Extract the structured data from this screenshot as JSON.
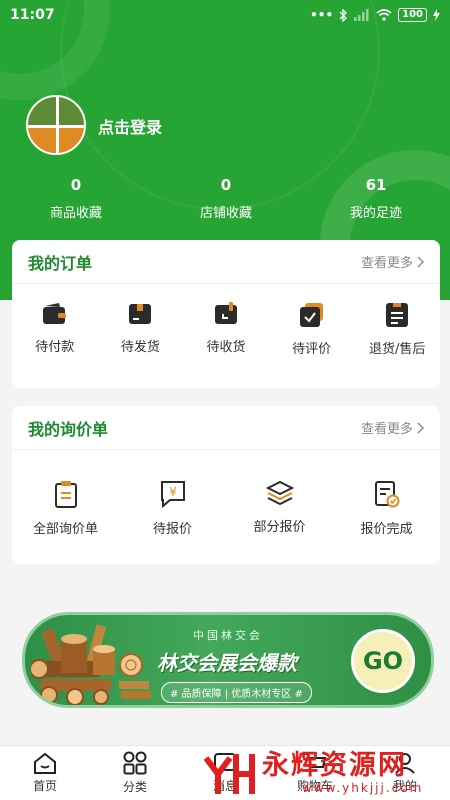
{
  "status_bar": {
    "time": "11:07",
    "battery": "100"
  },
  "profile": {
    "login_label": "点击登录"
  },
  "stats": [
    {
      "value": "0",
      "label": "商品收藏"
    },
    {
      "value": "0",
      "label": "店铺收藏"
    },
    {
      "value": "61",
      "label": "我的足迹"
    }
  ],
  "orders": {
    "title": "我的订单",
    "more": "查看更多",
    "items": [
      {
        "label": "待付款",
        "icon": "wallet-icon"
      },
      {
        "label": "待发货",
        "icon": "package-icon"
      },
      {
        "label": "待收货",
        "icon": "receive-box-icon"
      },
      {
        "label": "待评价",
        "icon": "review-icon"
      },
      {
        "label": "退货/售后",
        "icon": "return-icon"
      }
    ]
  },
  "inquiries": {
    "title": "我的询价单",
    "more": "查看更多",
    "items": [
      {
        "label": "全部询价单",
        "icon": "clipboard-list-icon"
      },
      {
        "label": "待报价",
        "icon": "yen-chat-icon"
      },
      {
        "label": "部分报价",
        "icon": "layers-icon"
      },
      {
        "label": "报价完成",
        "icon": "document-check-icon"
      }
    ]
  },
  "banner": {
    "subtitle": "中国林交会",
    "title": "林交会展会爆款",
    "tag": "# 品质保障 | 优质木材专区 #",
    "cta": "GO"
  },
  "tabbar": [
    {
      "label": "首页",
      "icon": "home-icon"
    },
    {
      "label": "分类",
      "icon": "grid-icon"
    },
    {
      "label": "消息",
      "icon": "message-icon"
    },
    {
      "label": "购物车",
      "icon": "cart-icon"
    },
    {
      "label": "我的",
      "icon": "user-icon"
    }
  ],
  "watermark": {
    "text": "永辉资源网",
    "url": "www.yhkjjj.com"
  },
  "colors": {
    "primary_green": "#27a534",
    "title_green": "#1f8a30",
    "watermark_red": "#e02020"
  }
}
